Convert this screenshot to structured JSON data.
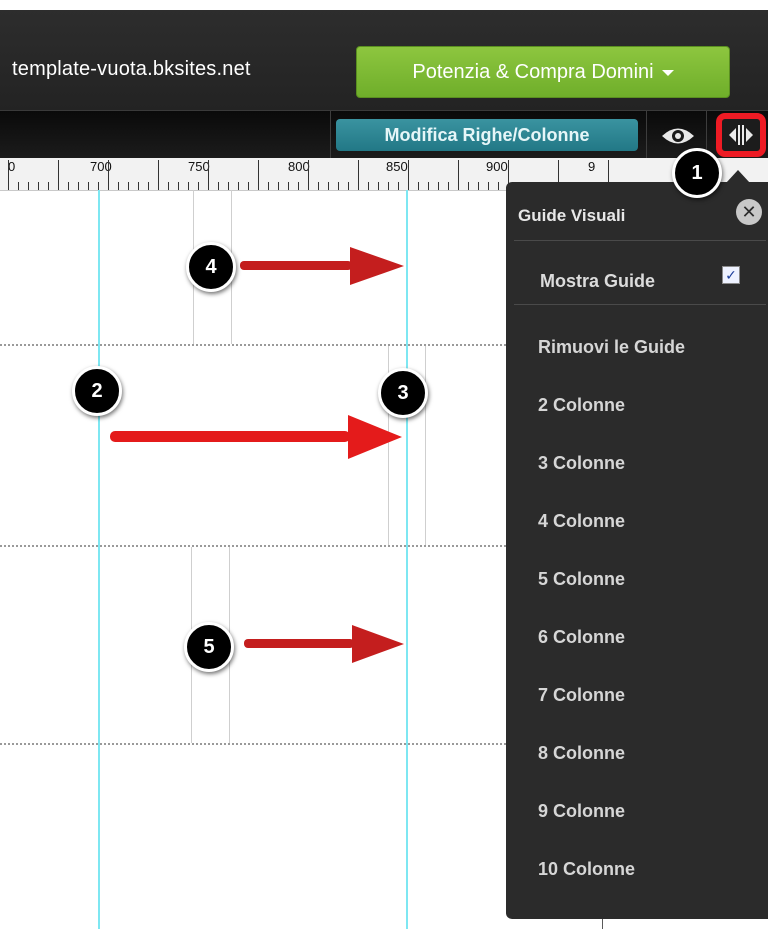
{
  "header": {
    "site_name": "template-vuota.bksites.net",
    "buy_button_label": "Potenzia & Compra Domini"
  },
  "toolbar": {
    "edit_rows_columns_label": "Modifica Righe/Colonne",
    "preview_icon": "eye-icon",
    "guides_icon": "column-guides-icon"
  },
  "ruler": {
    "labels": [
      "0",
      "700",
      "750",
      "800",
      "850",
      "900",
      "9"
    ]
  },
  "markers": [
    "1",
    "2",
    "3",
    "4",
    "5"
  ],
  "guides_panel": {
    "title": "Guide Visuali",
    "show_guides_label": "Mostra Guide",
    "show_guides_checked": true,
    "remove_guides_label": "Rimuovi le Guide",
    "column_options": [
      "2 Colonne",
      "3 Colonne",
      "4 Colonne",
      "5 Colonne",
      "6 Colonne",
      "7 Colonne",
      "8 Colonne",
      "9 Colonne",
      "10 Colonne"
    ]
  },
  "colors": {
    "buy_button": "#7bb833",
    "edit_button": "#2a8290",
    "highlight": "#ee1b24",
    "guide_line": "#7ee7f2",
    "arrow": "#c41e1e"
  }
}
